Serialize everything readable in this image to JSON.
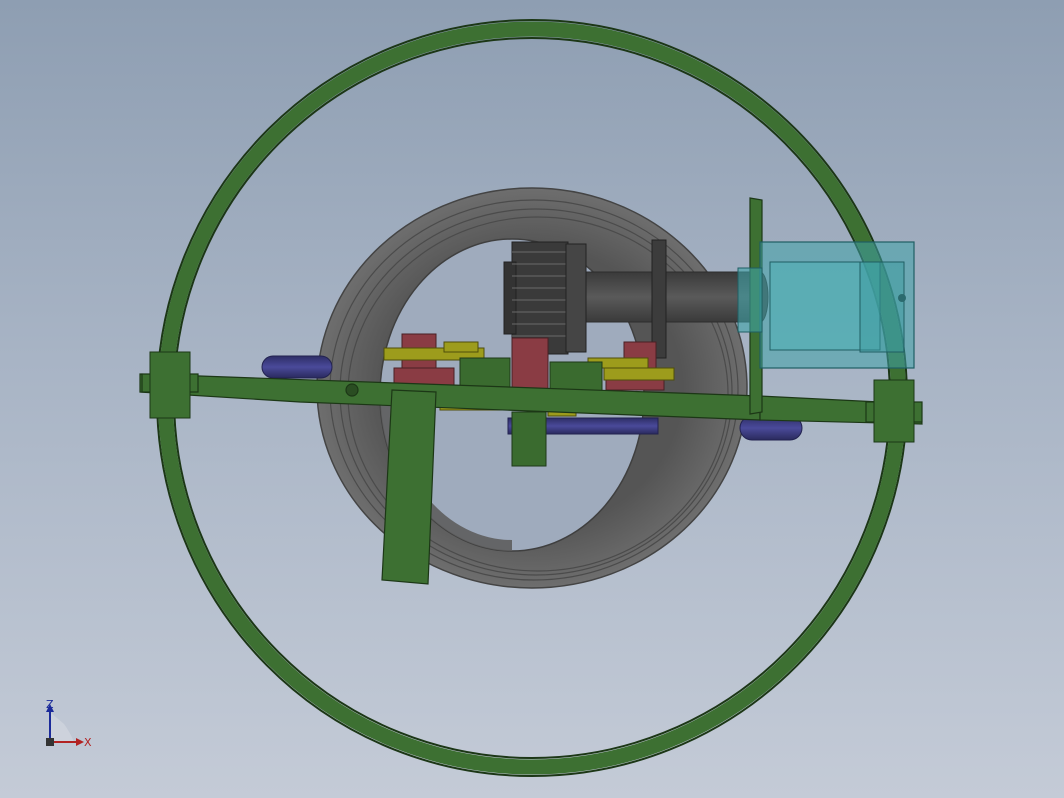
{
  "viewport": {
    "background_top": "#8e9eb2",
    "background_bottom": "#c4cbd7"
  },
  "model": {
    "outer_ring_color": "#3a6b2f",
    "coil_color": "#5f5f5f",
    "shaft_color": "#4a4a4a",
    "gear_color": "#3e3e3e",
    "cylinder_color": "#3b3b80",
    "red_block_color": "#8a3c44",
    "yellow_part_color": "#9d9c1c",
    "motor_color": "#3fa3a8"
  },
  "triad": {
    "z_label": "Z",
    "x_label": "X",
    "z_color": "#1b2a9a",
    "x_color": "#b22222",
    "icon": "coordinate-triad-icon"
  }
}
